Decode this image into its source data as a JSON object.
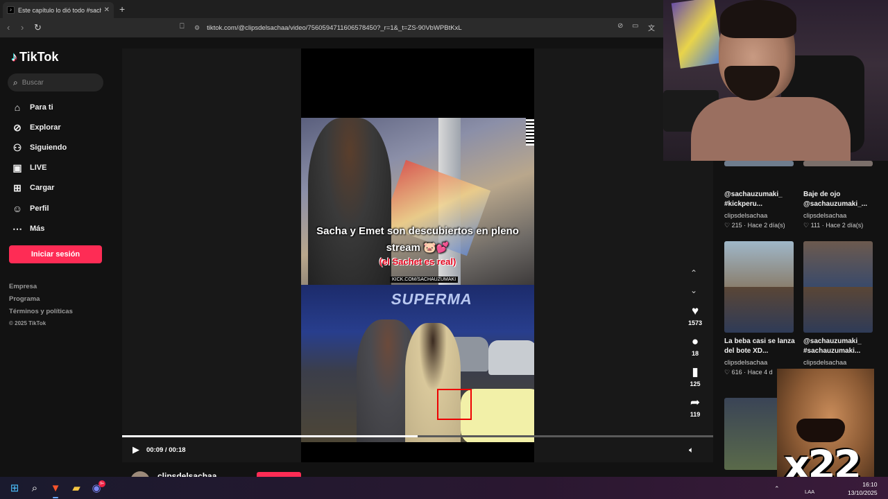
{
  "browser": {
    "tab_title": "Este capítulo lo dió todo #sacha",
    "tab_close": "✕",
    "new_tab": "+",
    "url": "tiktok.com/@clipsdelsachaa/video/7560594711606578450?_r=1&_t=ZS-90VbWPBtKxL"
  },
  "sidebar": {
    "brand": "TikTok",
    "search_placeholder": "Buscar",
    "nav": [
      {
        "label": "Para ti",
        "icon": "home-icon"
      },
      {
        "label": "Explorar",
        "icon": "compass-icon"
      },
      {
        "label": "Siguiendo",
        "icon": "following-icon"
      },
      {
        "label": "LIVE",
        "icon": "live-icon"
      },
      {
        "label": "Cargar",
        "icon": "upload-icon"
      },
      {
        "label": "Perfil",
        "icon": "profile-icon"
      },
      {
        "label": "Más",
        "icon": "more-icon"
      }
    ],
    "login_label": "Iniciar sesión",
    "footer_links": [
      "Empresa",
      "Programa",
      "Términos y políticas"
    ],
    "copyright": "© 2025 TikTok"
  },
  "video": {
    "caption_line1": "Sacha y Emet son descubiertos en pleno",
    "caption_line2": "stream 🐷💕",
    "caption_red": "(el Sachet es real)",
    "kick_tag": "KICK.COM/SACHAUZUMAKI",
    "store_sign": "SUPERMA",
    "time_label": "00:09 / 00:18",
    "progress": 0.5,
    "likes": "1573",
    "comments": "18",
    "saves": "125",
    "shares": "119",
    "author": "clipsdelsachaa"
  },
  "related": [
    {
      "title": "@sachauzumaki_ #kickperu...",
      "author": "clipsdelsachaa",
      "likes": "215",
      "age": "Hace 2 día(s)"
    },
    {
      "title": "Baje de ojo @sachauzumaki_...",
      "author": "clipsdelsachaa",
      "likes": "111",
      "age": "Hace 2 día(s)"
    },
    {
      "title": "La beba casi se lanza del bote XD...",
      "author": "clipsdelsachaa",
      "likes": "616",
      "age": "Hace 4 d"
    },
    {
      "title": "@sachauzumaki_ #sachauzumaki...",
      "author": "clipsdelsachaa",
      "likes": "",
      "age": ""
    }
  ],
  "overlay": {
    "meme_text": "x22"
  },
  "taskbar": {
    "lang": "LAA",
    "time": "16:10",
    "date": "13/10/2025",
    "discord_badge": "9+"
  }
}
